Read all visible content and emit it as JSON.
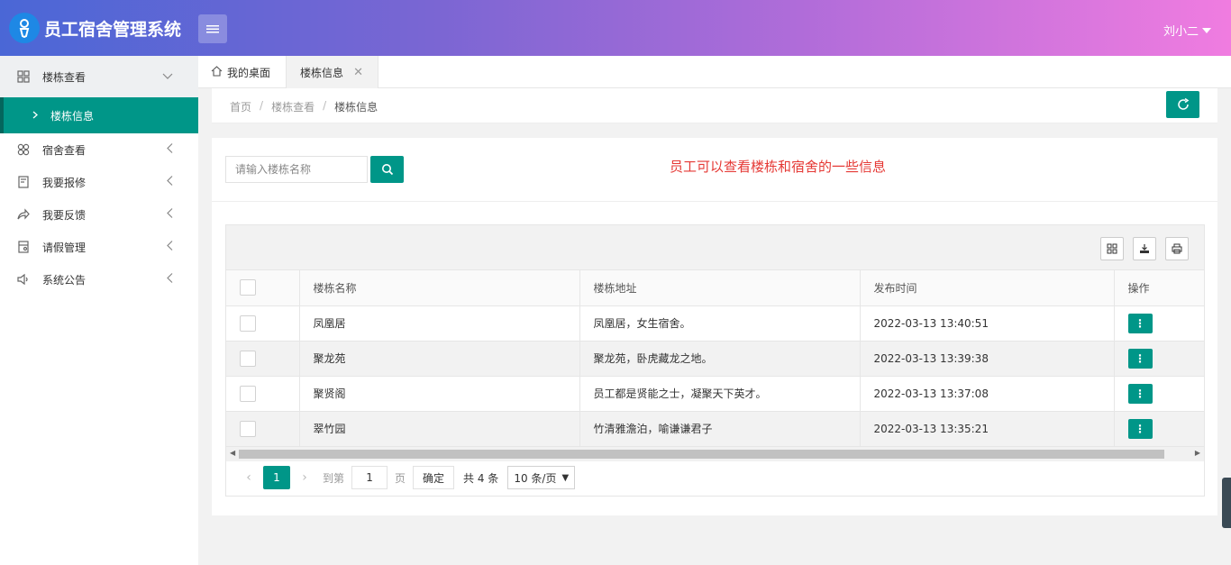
{
  "header": {
    "app_title": "员工宿舍管理系统",
    "user_name": "刘小二"
  },
  "sidebar": {
    "items": [
      {
        "label": "楼栋查看",
        "icon": "grid-icon",
        "children": [
          {
            "label": "楼栋信息"
          }
        ]
      },
      {
        "label": "宿舍查看",
        "icon": "clover-icon"
      },
      {
        "label": "我要报修",
        "icon": "report-icon"
      },
      {
        "label": "我要反馈",
        "icon": "share-icon"
      },
      {
        "label": "请假管理",
        "icon": "calendar-icon"
      },
      {
        "label": "系统公告",
        "icon": "speaker-icon"
      }
    ]
  },
  "tabs": {
    "home": "我的桌面",
    "active": "楼栋信息"
  },
  "breadcrumb": [
    "首页",
    "楼栋查看",
    "楼栋信息"
  ],
  "search": {
    "placeholder": "请输入楼栋名称",
    "value": ""
  },
  "note": "员工可以查看楼栋和宿舍的一些信息",
  "table": {
    "columns": [
      "楼栋名称",
      "楼栋地址",
      "发布时间",
      "操作"
    ],
    "rows": [
      {
        "name": "凤凰居",
        "address": "凤凰居，女生宿舍。",
        "time": "2022-03-13 13:40:51"
      },
      {
        "name": "聚龙苑",
        "address": "聚龙苑，卧虎藏龙之地。",
        "time": "2022-03-13 13:39:38"
      },
      {
        "name": "聚贤阁",
        "address": "员工都是贤能之士，凝聚天下英才。",
        "time": "2022-03-13 13:37:08"
      },
      {
        "name": "翠竹园",
        "address": "竹清雅澹泊，喻谦谦君子",
        "time": "2022-03-13 13:35:21"
      }
    ]
  },
  "pager": {
    "current": "1",
    "goto_label": "到第",
    "page_input": "1",
    "page_unit": "页",
    "confirm": "确定",
    "total": "共 4 条",
    "per_page": "10 条/页"
  },
  "colors": {
    "accent": "#009688",
    "note": "#e53935",
    "header_from": "#4a67d6",
    "header_to": "#f07ce0"
  }
}
